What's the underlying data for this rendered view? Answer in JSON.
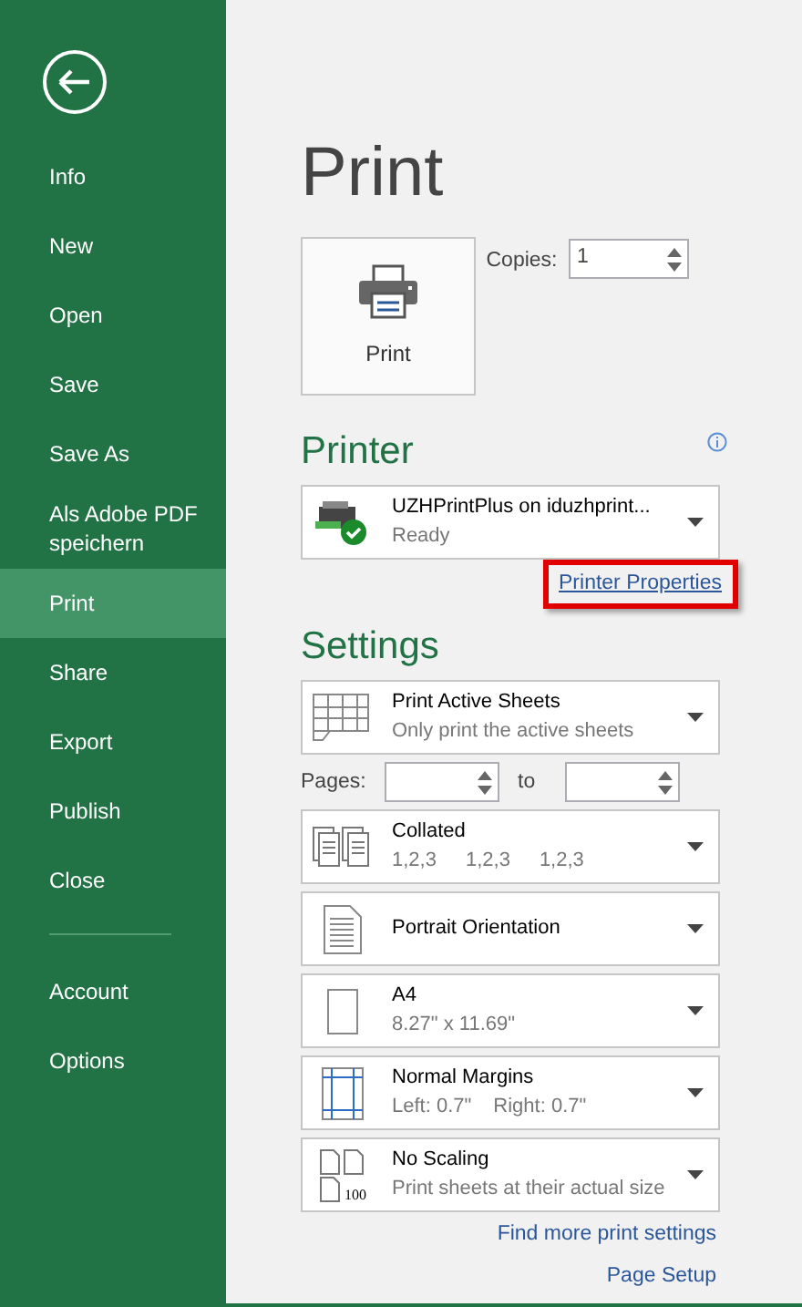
{
  "sidebar": {
    "items": [
      {
        "label": "Info",
        "selected": false
      },
      {
        "label": "New",
        "selected": false
      },
      {
        "label": "Open",
        "selected": false
      },
      {
        "label": "Save",
        "selected": false
      },
      {
        "label": "Save As",
        "selected": false
      },
      {
        "label": "Als Adobe PDF speichern",
        "selected": false
      },
      {
        "label": "Print",
        "selected": true
      },
      {
        "label": "Share",
        "selected": false
      },
      {
        "label": "Export",
        "selected": false
      },
      {
        "label": "Publish",
        "selected": false
      },
      {
        "label": "Close",
        "selected": false
      }
    ],
    "bottom_items": [
      {
        "label": "Account",
        "selected": false
      },
      {
        "label": "Options",
        "selected": false
      }
    ]
  },
  "title": "Print",
  "print_button": {
    "label": "Print"
  },
  "copies": {
    "label": "Copies:",
    "value": "1"
  },
  "printer": {
    "heading": "Printer",
    "name": "UZHPrintPlus on iduzhprint...",
    "status": "Ready",
    "properties_link": "Printer Properties",
    "highlighted": true
  },
  "settings": {
    "heading": "Settings",
    "items": [
      {
        "kind": "sheets",
        "title": "Print Active Sheets",
        "details": [
          "Only print the active sheets"
        ]
      },
      {
        "kind": "pages",
        "label": "Pages:",
        "to": "to"
      },
      {
        "kind": "collated",
        "title": "Collated",
        "details": [
          "1,2,3",
          "1,2,3",
          "1,2,3"
        ]
      },
      {
        "kind": "orientation",
        "title": "Portrait Orientation"
      },
      {
        "kind": "paper",
        "title": "A4",
        "details": [
          "8.27\" x 11.69\""
        ]
      },
      {
        "kind": "margins",
        "title": "Normal Margins",
        "details": [
          "Left:  0.7\"",
          "Right:  0.7\""
        ]
      },
      {
        "kind": "scaling",
        "title": "No Scaling",
        "icon_text": "100",
        "details": [
          "Print sheets at their actual size"
        ]
      }
    ]
  },
  "links": [
    "Find more print settings",
    "Page Setup"
  ]
}
